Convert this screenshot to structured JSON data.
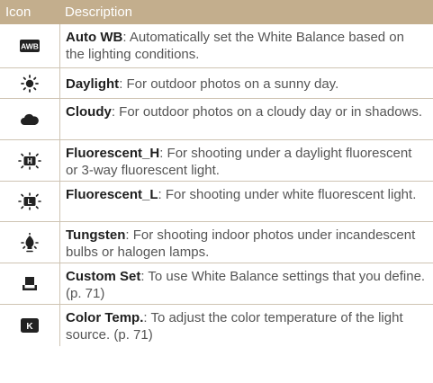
{
  "header": {
    "icon_label": "Icon",
    "description_label": "Description"
  },
  "colors": {
    "header_bg": "#c3ae8d",
    "row_divider": "#cfc4b3",
    "icon_dark": "#222222"
  },
  "rows": [
    {
      "icon": "auto-wb-icon",
      "icon_text": "AWB",
      "term": "Auto WB",
      "text": ": Automatically set the White Balance based on the lighting conditions."
    },
    {
      "icon": "daylight-icon",
      "term": "Daylight",
      "text": ": For outdoor photos on a sunny day."
    },
    {
      "icon": "cloudy-icon",
      "term": "Cloudy",
      "text": ": For outdoor photos on a cloudy day or in shadows."
    },
    {
      "icon": "fluorescent-h-icon",
      "icon_text": "H",
      "term": "Fluorescent_H",
      "text": ": For shooting under a daylight fluorescent or 3-way fluorescent light."
    },
    {
      "icon": "fluorescent-l-icon",
      "icon_text": "L",
      "term": "Fluorescent_L",
      "text": ": For shooting under white fluorescent light."
    },
    {
      "icon": "tungsten-icon",
      "term": "Tungsten",
      "text": ": For shooting indoor photos under incandescent bulbs or halogen lamps."
    },
    {
      "icon": "custom-set-icon",
      "term": "Custom Set",
      "text": ": To use White Balance settings that you define. (p. 71)"
    },
    {
      "icon": "color-temp-icon",
      "icon_text": "K",
      "term": "Color Temp.",
      "text": ": To adjust the color temperature of the light source. (p. 71)"
    }
  ]
}
